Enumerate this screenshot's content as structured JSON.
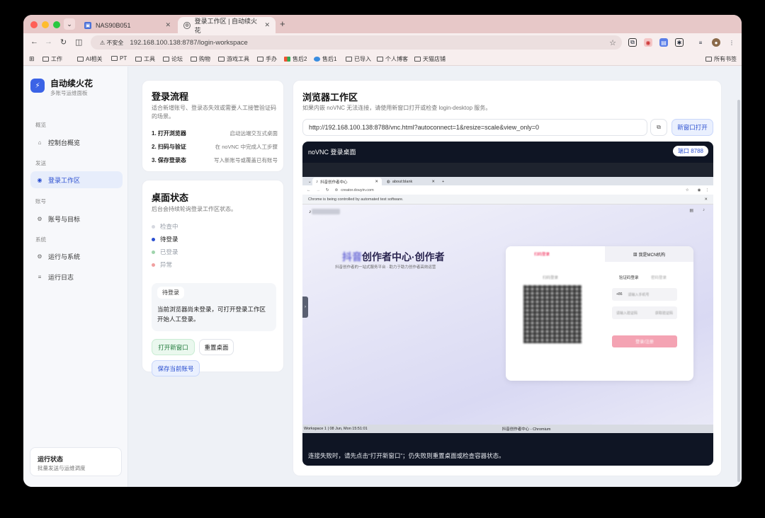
{
  "browser": {
    "tabs": [
      {
        "title": "NAS90B051",
        "active": false
      },
      {
        "title": "登录工作区 | 自动续火花",
        "active": true
      }
    ],
    "security_label": "不安全",
    "url": "192.168.100.138:8787/login-workspace",
    "bookmarks": [
      "工作",
      "AI相关",
      "PT",
      "工具",
      "论坛",
      "购物",
      "游戏工具",
      "手办",
      "售后2",
      "售后1",
      "已导入",
      "个人博客",
      "天猫店铺"
    ],
    "all_bookmarks": "所有书签"
  },
  "sidebar": {
    "brand_title": "自动续火花",
    "brand_subtitle": "多账号运维面板",
    "sections": [
      {
        "label": "概览",
        "items": [
          {
            "label": "控制台概览",
            "icon": "home-icon",
            "active": false
          }
        ]
      },
      {
        "label": "发送",
        "items": [
          {
            "label": "登录工作区",
            "icon": "target-icon",
            "active": true
          }
        ]
      },
      {
        "label": "账号",
        "items": [
          {
            "label": "账号与目标",
            "icon": "gear-icon",
            "active": false
          }
        ]
      },
      {
        "label": "系统",
        "items": [
          {
            "label": "运行与系统",
            "icon": "gear-icon",
            "active": false
          },
          {
            "label": "运行日志",
            "icon": "list-icon",
            "active": false
          }
        ]
      }
    ],
    "status_title": "运行状态",
    "status_subtitle": "批量发送与运维调度"
  },
  "flow": {
    "title": "登录流程",
    "desc": "适合新增账号、登录态失效或需要人工接管验证码的场景。",
    "steps": [
      {
        "k": "1. 打开浏览器",
        "v": "启动远端交互式桌面"
      },
      {
        "k": "2. 扫码与验证",
        "v": "在 noVNC 中完成人工步骤"
      },
      {
        "k": "3. 保存登录态",
        "v": "写入新账号或覆盖已有账号"
      }
    ]
  },
  "desktop": {
    "title": "桌面状态",
    "desc": "后台会持续轮询登录工作区状态。",
    "states": [
      {
        "label": "检查中",
        "color": "#d6d9e0",
        "text_color": "#9aa0aa"
      },
      {
        "label": "待登录",
        "color": "#2b4fd0",
        "text_color": "#222222"
      },
      {
        "label": "已登录",
        "color": "#9fd4ac",
        "text_color": "#9aa0aa"
      },
      {
        "label": "异常",
        "color": "#f0a0a0",
        "text_color": "#9aa0aa"
      }
    ],
    "state_pill": "待登录",
    "state_msg": "当前浏览器尚未登录，可打开登录工作区开始人工登录。",
    "btn_open": "打开新窗口",
    "btn_reset": "重置桌面",
    "btn_save": "保存当前账号"
  },
  "workspace": {
    "title": "浏览器工作区",
    "desc": "如果内嵌 noVNC 无法连接，请使用新窗口打开或检查 login-desktop 服务。",
    "vnc_url": "http://192.168.100.138:8788/vnc.html?autoconnect=1&resize=scale&view_only=0",
    "btn_open_new": "新窗口打开",
    "vnc_title": "noVNC 登录桌面",
    "port_badge": "端口 8788",
    "footer": "连接失败时，请先点击“打开新窗口”；仍失败则重置桌面或检查容器状态。"
  },
  "remote": {
    "tab1": "抖音创作者中心",
    "tab2": "about:blank",
    "address": "creator.douyin.com",
    "warning": "Chrome is being controlled by automated test software.",
    "hero": "创作者中心·创作者",
    "hero_prefix": "抖音",
    "hero_sub": "抖音创作者的一站式服务平台 · 助力于助力创作者高效运营",
    "login_tab_right": "我是MCN机构",
    "scan_label": "扫码登录",
    "code_login": "验证码登录",
    "pwd_login": "密码登录",
    "phone_prefix": "+86",
    "phone_ph": "请输入手机号",
    "code_ph": "请输入验证码",
    "get_code": "获取验证码",
    "login_btn": "登录/注册",
    "status_left": "Workspace 1 | 08 Jun, Mon 15:51:01",
    "status_right": "抖音创作者中心 - Chromium"
  }
}
